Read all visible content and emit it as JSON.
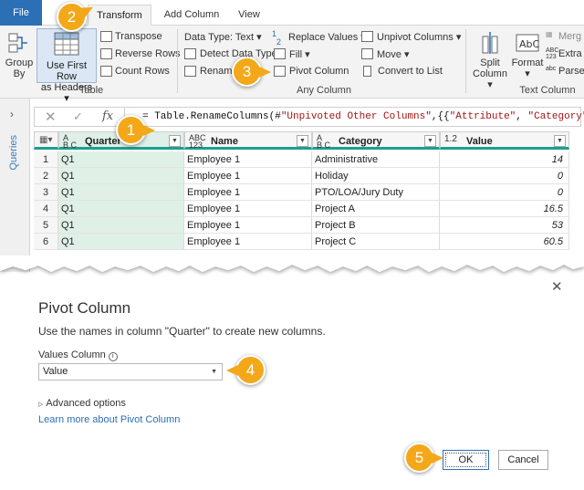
{
  "tabs": {
    "file": "File",
    "transform": "Transform",
    "add_column": "Add Column",
    "view": "View"
  },
  "ribbon": {
    "group_by": [
      "Group",
      "By"
    ],
    "use_first_row": [
      "Use First Row",
      "as Headers ▾"
    ],
    "transpose": "Transpose",
    "reverse_rows": "Reverse Rows",
    "count_rows": "Count Rows",
    "table_group": "Table",
    "data_type": "Data Type: Text ▾",
    "detect_data_type": "Detect Data Type",
    "rename": "Rename",
    "replace_values": "Replace Values ▾",
    "fill": "Fill ▾",
    "pivot_column": "Pivot Column",
    "unpivot_columns": "Unpivot Columns ▾",
    "move": "Move ▾",
    "convert_to_list": "Convert to List",
    "any_column_group": "Any Column",
    "split_column": [
      "Split",
      "Column ▾"
    ],
    "format": [
      "Format",
      "▾"
    ],
    "merge": "Merg",
    "extract": "Extra",
    "parse": "Parse",
    "text_column_group": "Text Column"
  },
  "queries_label": "Queries",
  "formula": {
    "fx": "fx",
    "prefix": "= Table.RenameColumns(#",
    "s1": "\"Unpivoted Other Columns\"",
    "mid": ",{{",
    "s2": "\"Attribute\"",
    "comma": ", ",
    "s3": "\"Category\"",
    "suffix": "}})"
  },
  "grid": {
    "headers": [
      {
        "type_top": "A",
        "type_bot": "B C",
        "name": "Quarter"
      },
      {
        "type_top": "ABC",
        "type_bot": "123",
        "name": "Name"
      },
      {
        "type_top": "A",
        "type_bot": "B C",
        "name": "Category"
      },
      {
        "type_top": "1.2",
        "type_bot": "",
        "name": "Value"
      }
    ],
    "rows": [
      {
        "idx": "1",
        "quarter": "Q1",
        "name": "Employee 1",
        "category": "Administrative",
        "value": "14"
      },
      {
        "idx": "2",
        "quarter": "Q1",
        "name": "Employee 1",
        "category": "Holiday",
        "value": "0"
      },
      {
        "idx": "3",
        "quarter": "Q1",
        "name": "Employee 1",
        "category": "PTO/LOA/Jury Duty",
        "value": "0"
      },
      {
        "idx": "4",
        "quarter": "Q1",
        "name": "Employee 1",
        "category": "Project A",
        "value": "16.5"
      },
      {
        "idx": "5",
        "quarter": "Q1",
        "name": "Employee 1",
        "category": "Project B",
        "value": "53"
      },
      {
        "idx": "6",
        "quarter": "Q1",
        "name": "Employee 1",
        "category": "Project C",
        "value": "60.5"
      }
    ]
  },
  "dialog": {
    "title": "Pivot Column",
    "subtitle": "Use the names in column \"Quarter\" to create new columns.",
    "values_column_label": "Values Column",
    "values_column_value": "Value",
    "advanced_options": "Advanced options",
    "learn_more": "Learn more about Pivot Column",
    "ok": "OK",
    "cancel": "Cancel",
    "close": "✕"
  },
  "callouts": [
    "1",
    "2",
    "3",
    "4",
    "5"
  ],
  "colors": {
    "accent": "#2b6fb5",
    "callout": "#f3a81a",
    "header_underline": "#1e9e8f",
    "selected_column": "#dff0e7"
  }
}
